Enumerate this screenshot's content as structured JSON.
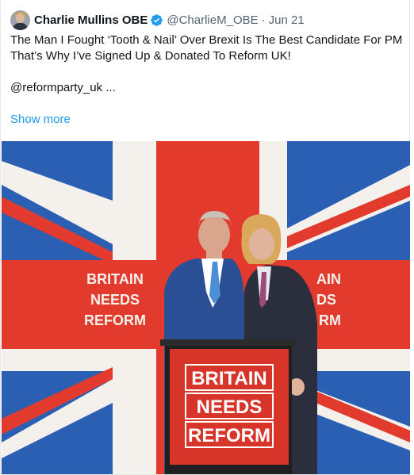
{
  "tweet": {
    "author_name": "Charlie Mullins OBE",
    "handle": "@CharlieM_OBE",
    "separator": "·",
    "date": "Jun 21",
    "text_line1": "The Man I Fought ‘Tooth & Nail’ Over Brexit Is The Best Candidate For PM",
    "text_line2": "That’s Why I’ve Signed Up & Donated To Reform UK!",
    "text_line3": "@reformparty_uk ...",
    "show_more": "Show more",
    "icons": [
      "avatar",
      "verified-badge-icon"
    ],
    "colors": {
      "link": "#1d9bf0",
      "verified": "#1d9bf0",
      "secondary_text": "#536471"
    }
  },
  "media": {
    "banner_text_line1": "BRITAIN",
    "banner_text_line2": "NEEDS",
    "banner_text_line3": "REFORM",
    "right_banner_line1": "AIN",
    "right_banner_line2": "DS",
    "right_banner_line3": "RM",
    "podium_line1": "BRITAIN",
    "podium_line2": "NEEDS",
    "podium_line3": "REFORM",
    "colors": {
      "flag_blue": "#2a5fb4",
      "flag_red": "#e23a2c",
      "flag_white": "#f4f1ec",
      "podium_red": "#d8352a"
    }
  }
}
